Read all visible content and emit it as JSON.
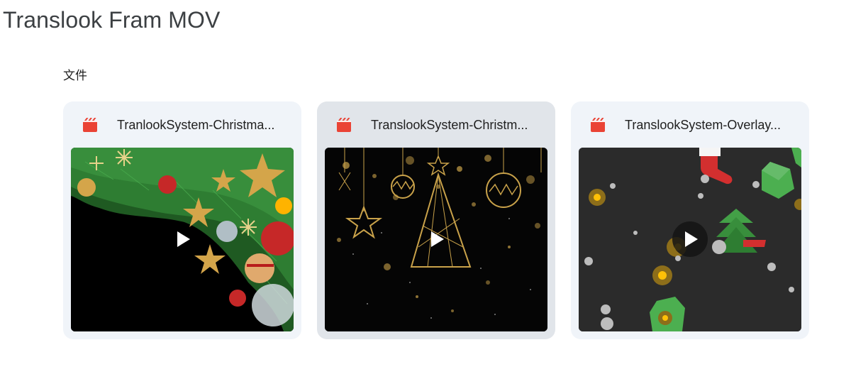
{
  "header": {
    "title": "Translook Fram MOV"
  },
  "section": {
    "label": "文件"
  },
  "files": [
    {
      "name": "TranlookSystem-Christma...",
      "icon": "video-file-icon",
      "icon_color": "#ea4335"
    },
    {
      "name": "TranslookSystem-Christm...",
      "icon": "video-file-icon",
      "icon_color": "#ea4335"
    },
    {
      "name": "TranslookSystem-Overlay...",
      "icon": "video-file-icon",
      "icon_color": "#ea4335"
    }
  ],
  "colors": {
    "card_background": "#f0f4f9",
    "card_hover_background": "#e1e5ea",
    "title_text": "#3c4043"
  }
}
